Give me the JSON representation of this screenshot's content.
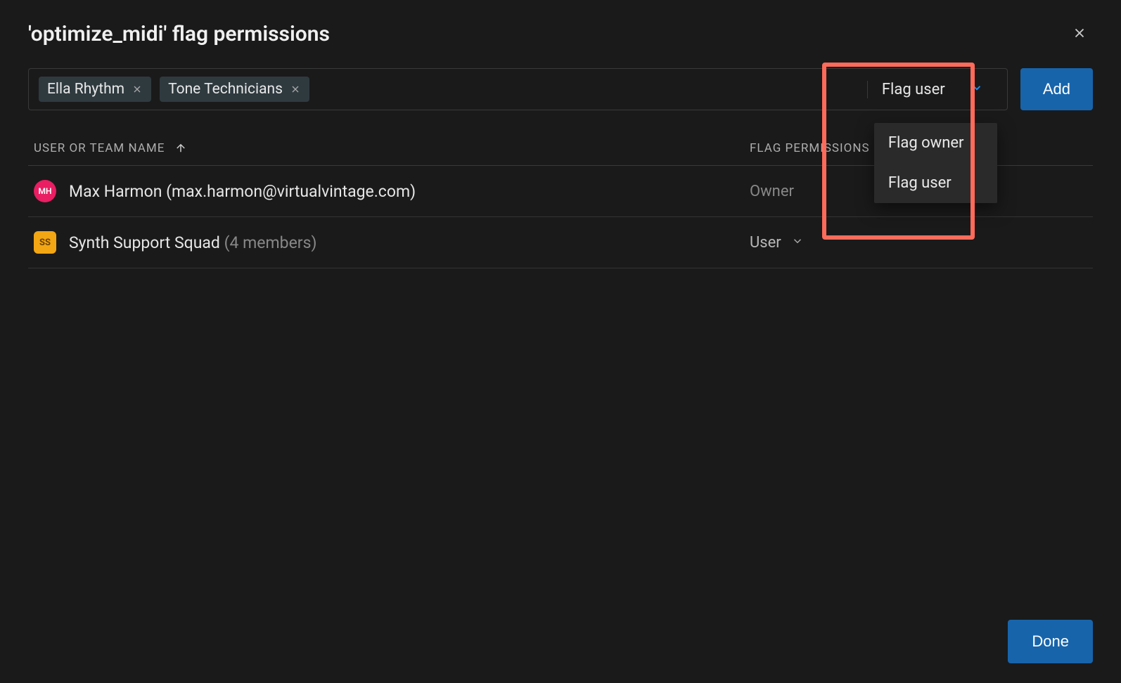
{
  "title": "'optimize_midi' flag permissions",
  "addRow": {
    "chips": [
      {
        "label": "Ella Rhythm"
      },
      {
        "label": "Tone Technicians"
      }
    ],
    "permissionSelected": "Flag user",
    "dropdown": [
      "Flag owner",
      "Flag user"
    ],
    "addLabel": "Add"
  },
  "table": {
    "headName": "USER OR TEAM NAME",
    "headPermission": "FLAG PERMISSIONS",
    "rows": [
      {
        "avatarInitials": "MH",
        "avatarClass": "avatar-pink",
        "name": "Max Harmon (max.harmon@virtualvintage.com)",
        "meta": "",
        "permission": "Owner",
        "editable": false
      },
      {
        "avatarInitials": "SS",
        "avatarClass": "avatar-square",
        "name": "Synth Support Squad",
        "meta": "(4 members)",
        "permission": "User",
        "editable": true
      }
    ]
  },
  "footer": {
    "doneLabel": "Done"
  }
}
